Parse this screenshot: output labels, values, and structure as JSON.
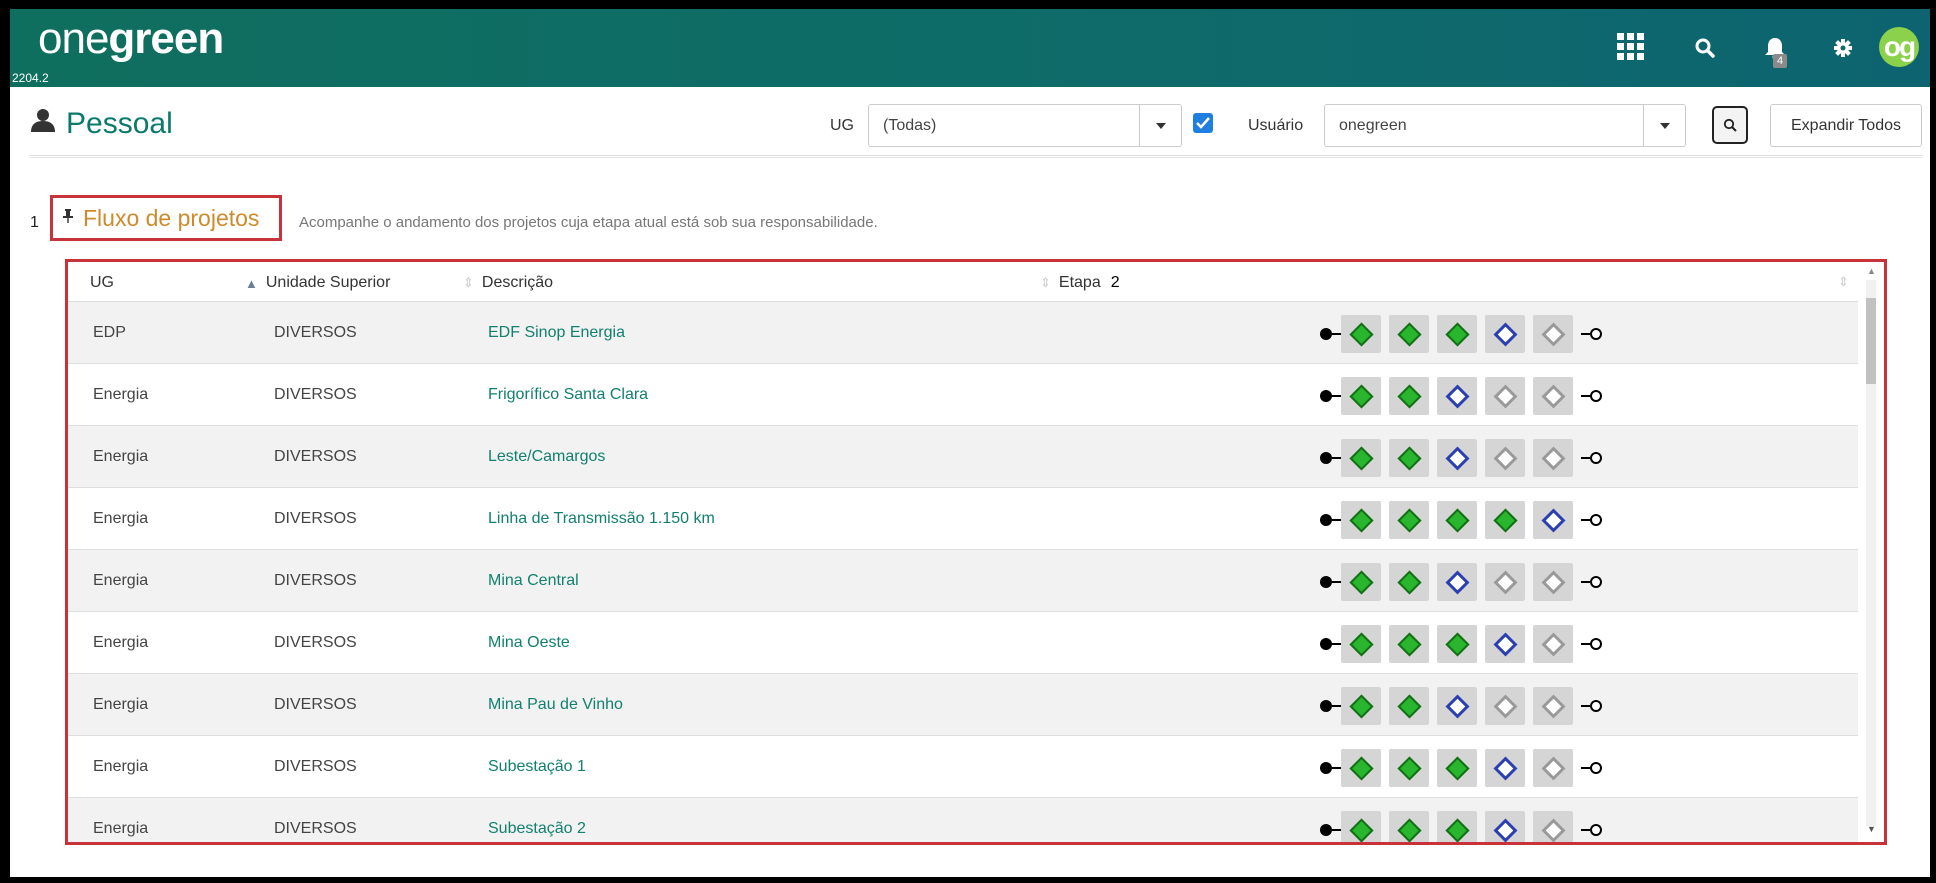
{
  "app": {
    "logo_light": "one",
    "logo_bold": "green",
    "version": "2204.2",
    "notification_count": "4",
    "avatar_initials": "og"
  },
  "header": {
    "title": "Pessoal",
    "ug_label": "UG",
    "ug_value": "(Todas)",
    "ug_checkbox_checked": true,
    "user_label": "Usuário",
    "user_value": "onegreen",
    "expand_label": "Expandir Todos"
  },
  "section": {
    "number": "1",
    "title": "Fluxo de projetos",
    "description": "Acompanhe o andamento dos projetos cuja etapa atual está sob sua responsabilidade."
  },
  "table": {
    "columns": [
      "UG",
      "Unidade Superior",
      "Descrição",
      "Etapa"
    ],
    "etapa_marker": "2",
    "rows": [
      {
        "ug": "EDP",
        "unidade": "DIVERSOS",
        "descricao": "EDF Sinop Energia",
        "etapas": [
          "green",
          "green",
          "green",
          "blue",
          "gray"
        ]
      },
      {
        "ug": "Energia",
        "unidade": "DIVERSOS",
        "descricao": "Frigorífico Santa Clara",
        "etapas": [
          "green",
          "green",
          "blue",
          "gray",
          "gray"
        ]
      },
      {
        "ug": "Energia",
        "unidade": "DIVERSOS",
        "descricao": "Leste/Camargos",
        "etapas": [
          "green",
          "green",
          "blue",
          "gray",
          "gray"
        ]
      },
      {
        "ug": "Energia",
        "unidade": "DIVERSOS",
        "descricao": "Linha de Transmissão 1.150 km",
        "etapas": [
          "green",
          "green",
          "green",
          "green",
          "blue"
        ]
      },
      {
        "ug": "Energia",
        "unidade": "DIVERSOS",
        "descricao": "Mina Central",
        "etapas": [
          "green",
          "green",
          "blue",
          "gray",
          "gray"
        ]
      },
      {
        "ug": "Energia",
        "unidade": "DIVERSOS",
        "descricao": "Mina Oeste",
        "etapas": [
          "green",
          "green",
          "green",
          "blue",
          "gray"
        ]
      },
      {
        "ug": "Energia",
        "unidade": "DIVERSOS",
        "descricao": "Mina Pau de Vinho",
        "etapas": [
          "green",
          "green",
          "blue",
          "gray",
          "gray"
        ]
      },
      {
        "ug": "Energia",
        "unidade": "DIVERSOS",
        "descricao": "Subestação 1",
        "etapas": [
          "green",
          "green",
          "green",
          "blue",
          "gray"
        ]
      },
      {
        "ug": "Energia",
        "unidade": "DIVERSOS",
        "descricao": "Subestação 2",
        "etapas": [
          "green",
          "green",
          "green",
          "blue",
          "gray"
        ]
      }
    ]
  },
  "colors": {
    "brand": "#0e6b6a",
    "accent_orange": "#d08a2c",
    "link_green": "#11806e",
    "highlight_red": "#c8323a",
    "step_done": "#2ab52e",
    "step_current": "#2c3fb0",
    "step_pending": "#999999"
  },
  "icons": [
    "apps-grid-icon",
    "search-icon",
    "bell-icon",
    "gear-icon",
    "user-icon",
    "pin-icon",
    "chevron-down-icon",
    "check-icon",
    "sort-icon"
  ]
}
